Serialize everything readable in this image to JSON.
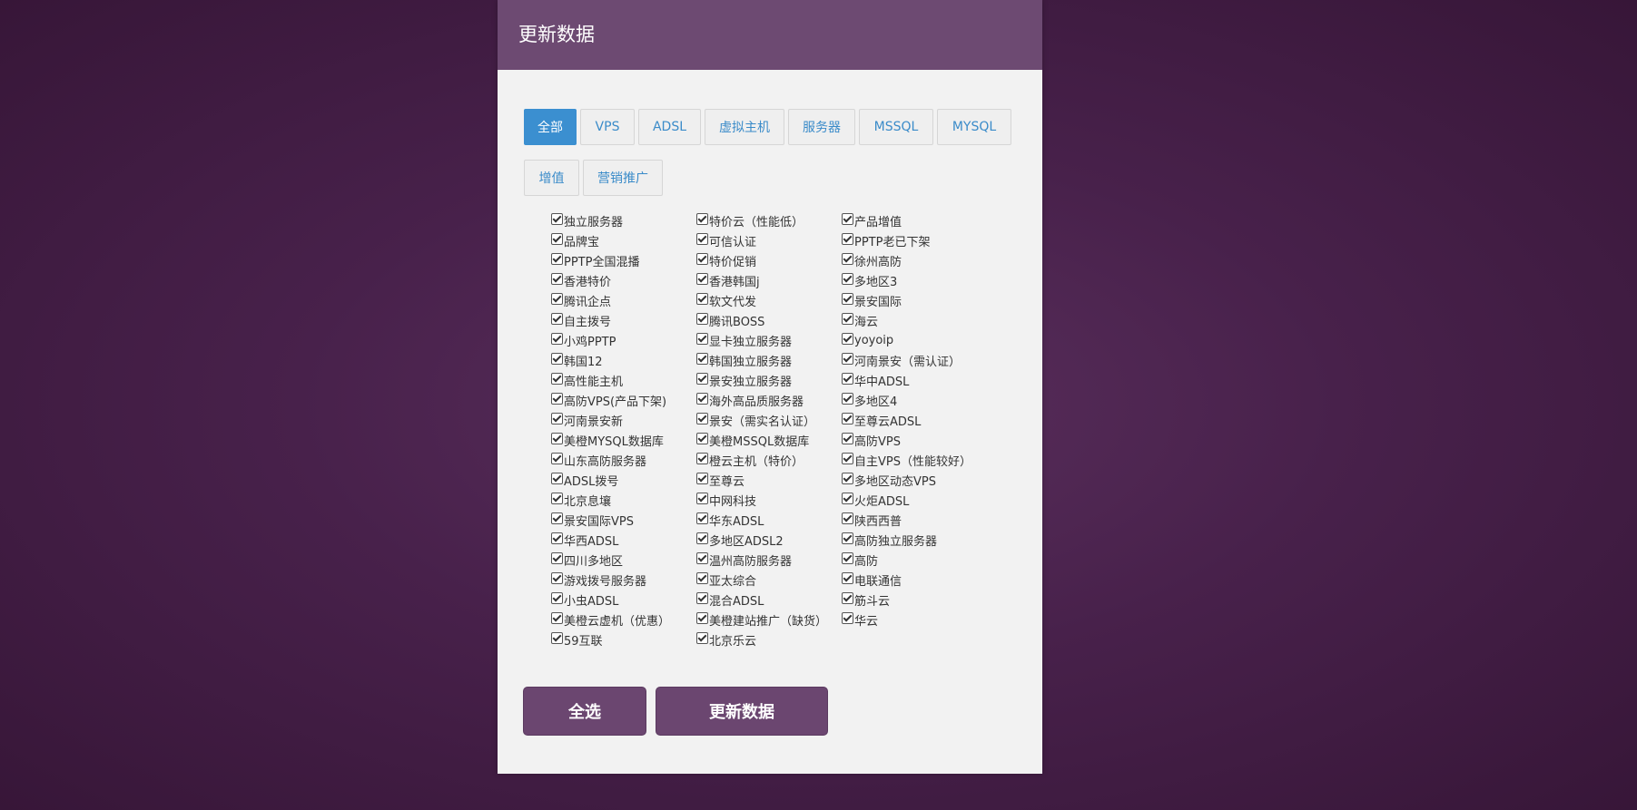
{
  "header": {
    "title": "更新数据"
  },
  "tabs": [
    {
      "label": "全部",
      "active": true
    },
    {
      "label": "VPS"
    },
    {
      "label": "ADSL"
    },
    {
      "label": "虚拟主机"
    },
    {
      "label": "服务器"
    },
    {
      "label": "MSSQL"
    },
    {
      "label": "MYSQL"
    },
    {
      "label": "增值"
    },
    {
      "label": "营销推广"
    }
  ],
  "items": [
    "独立服务器",
    "特价云（性能低）",
    "产品增值",
    "品牌宝",
    "可信认证",
    "PPTP老已下架",
    "PPTP全国混播",
    "特价促销",
    "徐州高防",
    "香港特价",
    "香港韩国j",
    "多地区3",
    "腾讯企点",
    "软文代发",
    "景安国际",
    "自主拨号",
    "腾讯BOSS",
    "海云",
    "小鸡PPTP",
    "显卡独立服务器",
    "yoyoip",
    "韩国12",
    "韩国独立服务器",
    "河南景安（需认证）",
    "高性能主机",
    "景安独立服务器",
    "华中ADSL",
    "高防VPS(产品下架)",
    "海外高品质服务器",
    "多地区4",
    "河南景安新",
    "景安（需实名认证）",
    "至尊云ADSL",
    "美橙MYSQL数据库",
    "美橙MSSQL数据库",
    "高防VPS",
    "山东高防服务器",
    "橙云主机（特价）",
    "自主VPS（性能较好）",
    "ADSL拨号",
    "至尊云",
    "多地区动态VPS",
    "北京息壤",
    "中网科技",
    "火炬ADSL",
    "景安国际VPS",
    "华东ADSL",
    "陕西西普",
    "华西ADSL",
    "多地区ADSL2",
    "高防独立服务器",
    "四川多地区",
    "温州高防服务器",
    "高防",
    "游戏拨号服务器",
    "亚太综合",
    "电联通信",
    "小虫ADSL",
    "混合ADSL",
    "筋斗云",
    "美橙云虚机（优惠）",
    "美橙建站推广（缺货）",
    "华云",
    "59互联",
    "北京乐云"
  ],
  "buttons": {
    "select_all": "全选",
    "update": "更新数据"
  }
}
